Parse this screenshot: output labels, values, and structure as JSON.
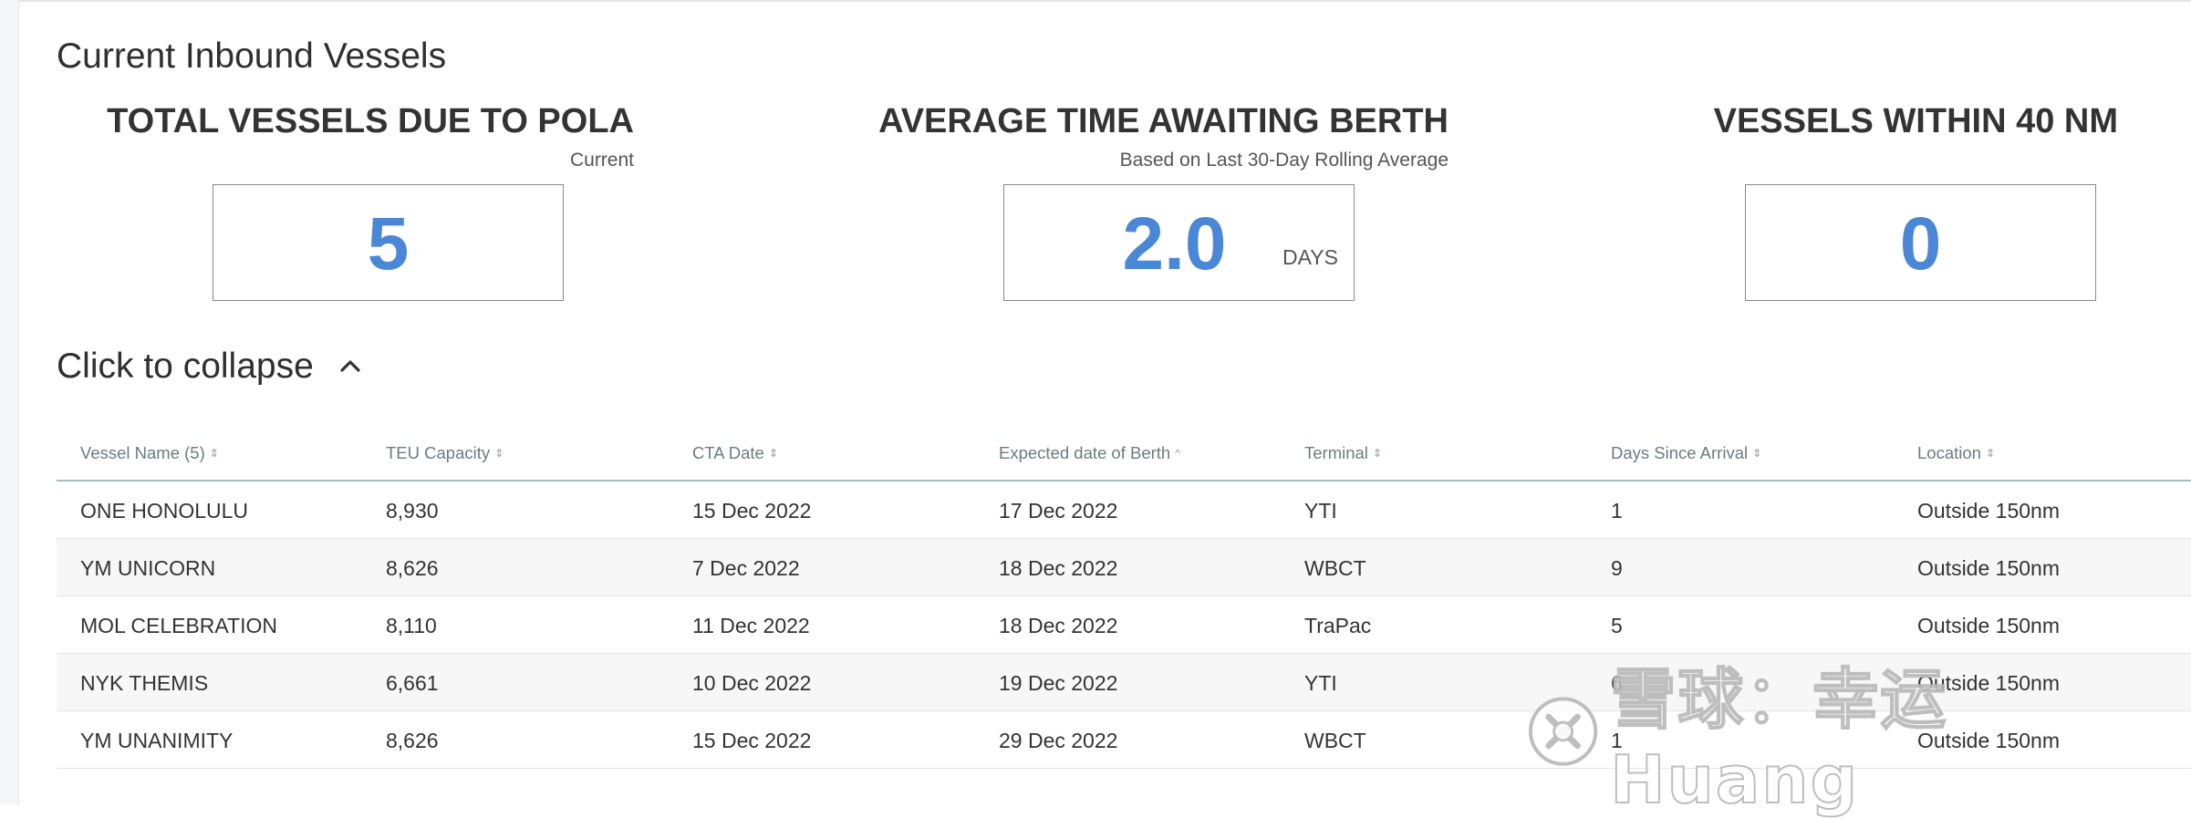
{
  "section_title": "Current Inbound Vessels",
  "kpis": {
    "total": {
      "title": "TOTAL VESSELS DUE TO POLA",
      "subtitle": "Current",
      "value": "5"
    },
    "avg_berth": {
      "title": "AVERAGE TIME AWAITING BERTH",
      "subtitle": "Based on Last 30-Day Rolling Average",
      "value": "2.0",
      "unit": "DAYS"
    },
    "within": {
      "title": "VESSELS WITHIN 40 NM",
      "value": "0"
    }
  },
  "collapse_label": "Click to collapse",
  "table": {
    "columns": [
      {
        "label": "Vessel Name (5)",
        "sort": "both"
      },
      {
        "label": "TEU Capacity",
        "sort": "both"
      },
      {
        "label": "CTA Date",
        "sort": "both"
      },
      {
        "label": "Expected date of Berth",
        "sort": "asc"
      },
      {
        "label": "Terminal",
        "sort": "both"
      },
      {
        "label": "Days Since Arrival",
        "sort": "both"
      },
      {
        "label": "Location",
        "sort": "both"
      }
    ],
    "rows": [
      [
        "ONE HONOLULU",
        "8,930",
        "15 Dec 2022",
        "17 Dec 2022",
        "YTI",
        "1",
        "Outside 150nm"
      ],
      [
        "YM UNICORN",
        "8,626",
        "7 Dec 2022",
        "18 Dec 2022",
        "WBCT",
        "9",
        "Outside 150nm"
      ],
      [
        "MOL CELEBRATION",
        "8,110",
        "11 Dec 2022",
        "18 Dec 2022",
        "TraPac",
        "5",
        "Outside 150nm"
      ],
      [
        "NYK THEMIS",
        "6,661",
        "10 Dec 2022",
        "19 Dec 2022",
        "YTI",
        "6",
        "Outside 150nm"
      ],
      [
        "YM UNANIMITY",
        "8,626",
        "15 Dec 2022",
        "29 Dec 2022",
        "WBCT",
        "1",
        "Outside 150nm"
      ]
    ]
  },
  "watermark": {
    "text": "雪球：幸运Huang"
  },
  "colors": {
    "accent": "#4a87d6",
    "header_text": "#6b7b84",
    "divider": "#a7bcbc",
    "row_alt": "#f7f7f7"
  },
  "icons": {
    "collapse": "chevron-up-icon",
    "sort": "sort-both-icon",
    "sort_asc": "sort-asc-icon",
    "watermark_logo": "xueqiu-logo-icon"
  }
}
